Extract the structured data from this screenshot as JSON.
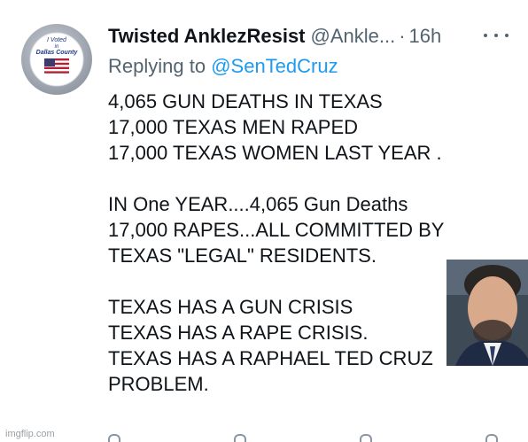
{
  "author": {
    "name": "Twisted AnklezResist",
    "handle": "@Ankle...",
    "separator": "·",
    "time": "16h",
    "avatar_text": [
      "I Voted",
      "in",
      "Dallas County"
    ]
  },
  "reply": {
    "prefix": "Replying to",
    "handle": "@SenTedCruz"
  },
  "tweet_lines": [
    "4,065 GUN DEATHS IN TEXAS",
    "17,000 TEXAS MEN RAPED",
    "17,000 TEXAS WOMEN LAST YEAR .",
    "",
    "IN One YEAR....4,065 Gun Deaths",
    "17,000 RAPES...ALL COMMITTED BY",
    "TEXAS \"LEGAL\" RESIDENTS.",
    "",
    "TEXAS HAS A GUN CRISIS",
    "TEXAS HAS A RAPE CRISIS.",
    "TEXAS HAS A RAPHAEL TED CRUZ",
    "PROBLEM."
  ],
  "watermark": "imgflip.com",
  "colors": {
    "text_primary": "#0f1419",
    "text_secondary": "#536471",
    "link": "#1d9bf0"
  },
  "icons": [
    "more-icon",
    "reply-icon",
    "retweet-icon",
    "like-icon",
    "share-icon"
  ]
}
